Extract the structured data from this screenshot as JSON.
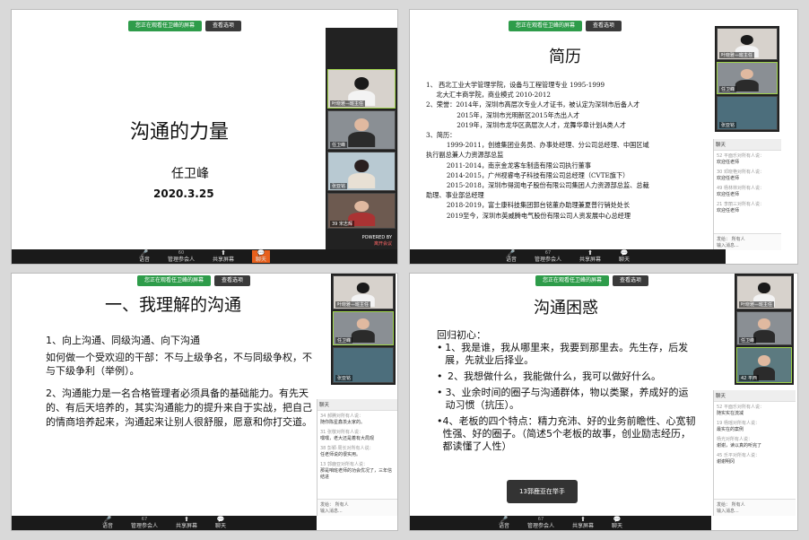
{
  "common": {
    "banner_label": "您正在观看任卫峰的屏幕",
    "view_options_label": "查看选项",
    "toolbar": {
      "labels": [
        "语音",
        "管理参会人",
        "共享屏幕",
        "聊天"
      ],
      "count_a": "60",
      "count_b": "67"
    },
    "chat_send_to_label": "发给：",
    "chat_send_to_value": "所有人",
    "chat_input_placeholder": "输入消息..."
  },
  "panel1": {
    "title": "沟通的力量",
    "author": "任卫峰",
    "date": "2020.3.25",
    "participants": [
      "叶晓雅—班主任",
      "任卫峰",
      "张亚铭",
      "39 宋志辉"
    ],
    "powered_by": "POWERED BY",
    "leave_label": "离开会议"
  },
  "panel2": {
    "title": "简历",
    "lines": [
      "1、 西北工业大学管理学院，设备与工程管理专业 1995-1999",
      "     北大汇丰商学院，商业模式 2010-2012",
      "2、荣誉：2014年，深圳市高层次专业人才证书，被认定为深圳市后备人才",
      "               2015年，深圳市光明新区2015年杰出人才",
      "               2019年，深圳市龙华区高层次人才，龙舞华章计划A类人才",
      "3、简历：",
      "          1999-2011，创维集团业务员、办事处经理、分公司总经理、中国区域",
      "执行副总兼人力资源部总监",
      "          2011-2014，南京金龙客车制造有限公司执行董事",
      "          2014-2015，广州视睿电子科技有限公司总经理（CVTE旗下）",
      "          2015-2018，深圳市得润电子股份有限公司集团人力资源部总监、总裁",
      "助理、事业部总经理",
      "          2018-2019，富士康科技集团郭台铭董办助理兼夏普行销处处长",
      "          2019至今，深圳市英威腾电气股份有限公司人资发展中心总经理"
    ],
    "participants": [
      "叶晓雅—班主任",
      "任卫峰",
      "张亚铭"
    ],
    "chat_header": "聊天",
    "chat_messages": [
      {
        "from": "52 平面乐对所有人说：",
        "text": "欢迎任老师"
      },
      {
        "from": "30 邓晓艳对所有人说：",
        "text": "欢迎任老师"
      },
      {
        "from": "49 杨林林对所有人说：",
        "text": "欢迎任老师"
      },
      {
        "from": "21 李丽三对所有人说：",
        "text": "欢迎任老师"
      }
    ]
  },
  "panel3": {
    "title": "一、我理解的沟通",
    "p1_head": "1、向上沟通、同级沟通、向下沟通",
    "p1_body": "如何做一个受欢迎的干部：不与上级争名，不与同级争权，不与下级争利（举例）。",
    "p2": "2、沟通能力是一名合格管理者必须具备的基础能力。有先天的、有后天培养的，其实沟通能力的提升来自于实战，把自己的情商培养起来，沟通起来让别人很舒服，愿意和你打交道。",
    "participants": [
      "叶晓雅—班主任",
      "任卫峰",
      "张亚铭"
    ],
    "chat_header": "聊天",
    "chat_messages": [
      {
        "from": "34 郝腾对所有人说：",
        "text": "随你陈星鑫羡太家的。"
      },
      {
        "from": "31 张敬对所有人说：",
        "text": "嘿嘿，老大还是着有大局观"
      },
      {
        "from": "38 彭颖·周长对所有人说：",
        "text": "任老师说的很实用。"
      },
      {
        "from": "13 郭鹿亚对所有人说：",
        "text": "那是咱班老师的功会优况了，三年信结进"
      }
    ]
  },
  "panel4": {
    "title": "沟通困惑",
    "intro": "回归初心：",
    "bullets": [
      "1、我是谁，我从哪里来，我要到那里去。先生存，后发展，先就业后择业。",
      "2、我想做什么，我能做什么，我可以做好什么。",
      "3、业余时间的圈子与沟通群体，物以类聚，养成好的运动习惯（抗压）。",
      "4、老板的四个特点：精力充沛、好的业务前瞻性、心宽韧性强、好的圈子。（简述5个老板的故事，创业励志经历，都读懂了人性）"
    ],
    "toast": "13郭鹿亚在举手",
    "participants": [
      "叶晓雅—班主任",
      "任卫峰",
      "42 平西"
    ],
    "chat_header": "聊天",
    "chat_messages": [
      {
        "from": "52 平面乐对所有人说：",
        "text": "随实实在流减"
      },
      {
        "from": "19 杨瑶对所有人说：",
        "text": "最实在的案例"
      },
      {
        "from": "杨光对所有人说：",
        "text": "谢谢，读以真的听完了"
      },
      {
        "from": "45 乐平对所有人说：",
        "text": "谢谢明冈"
      }
    ]
  }
}
